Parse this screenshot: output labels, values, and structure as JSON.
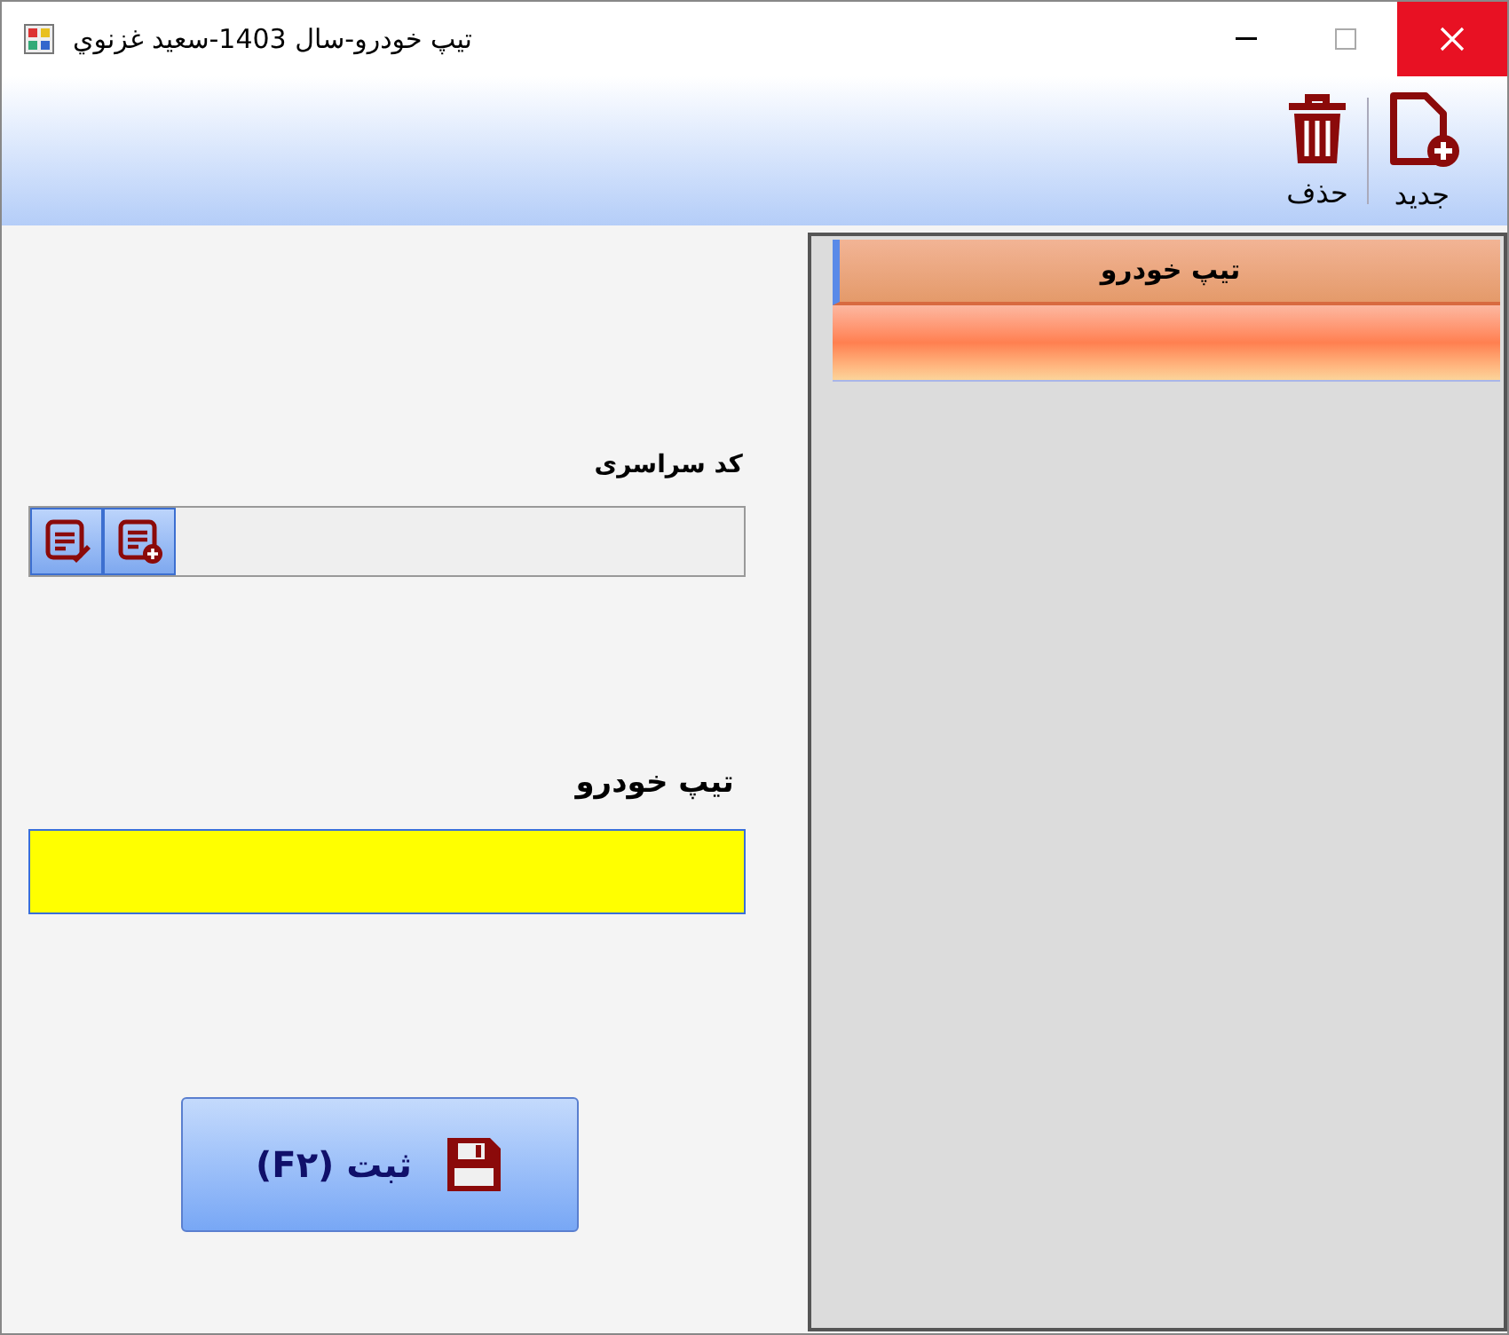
{
  "window": {
    "title": "تیپ خودرو-سال 1403-سعيد غزنوي"
  },
  "toolbar": [
    {
      "kind": "new",
      "label": "جديد"
    },
    {
      "kind": "delete",
      "label": "حذف"
    }
  ],
  "grid": {
    "columns": [
      "تیپ خودرو"
    ],
    "rows": [
      {
        "selected": true
      }
    ]
  },
  "form": {
    "global_code": {
      "label": "کد سراسری"
    },
    "car_type": {
      "label": "تیپ خودرو",
      "focused": true
    }
  },
  "save_button": {
    "label": "ثبت (F۲)"
  }
}
